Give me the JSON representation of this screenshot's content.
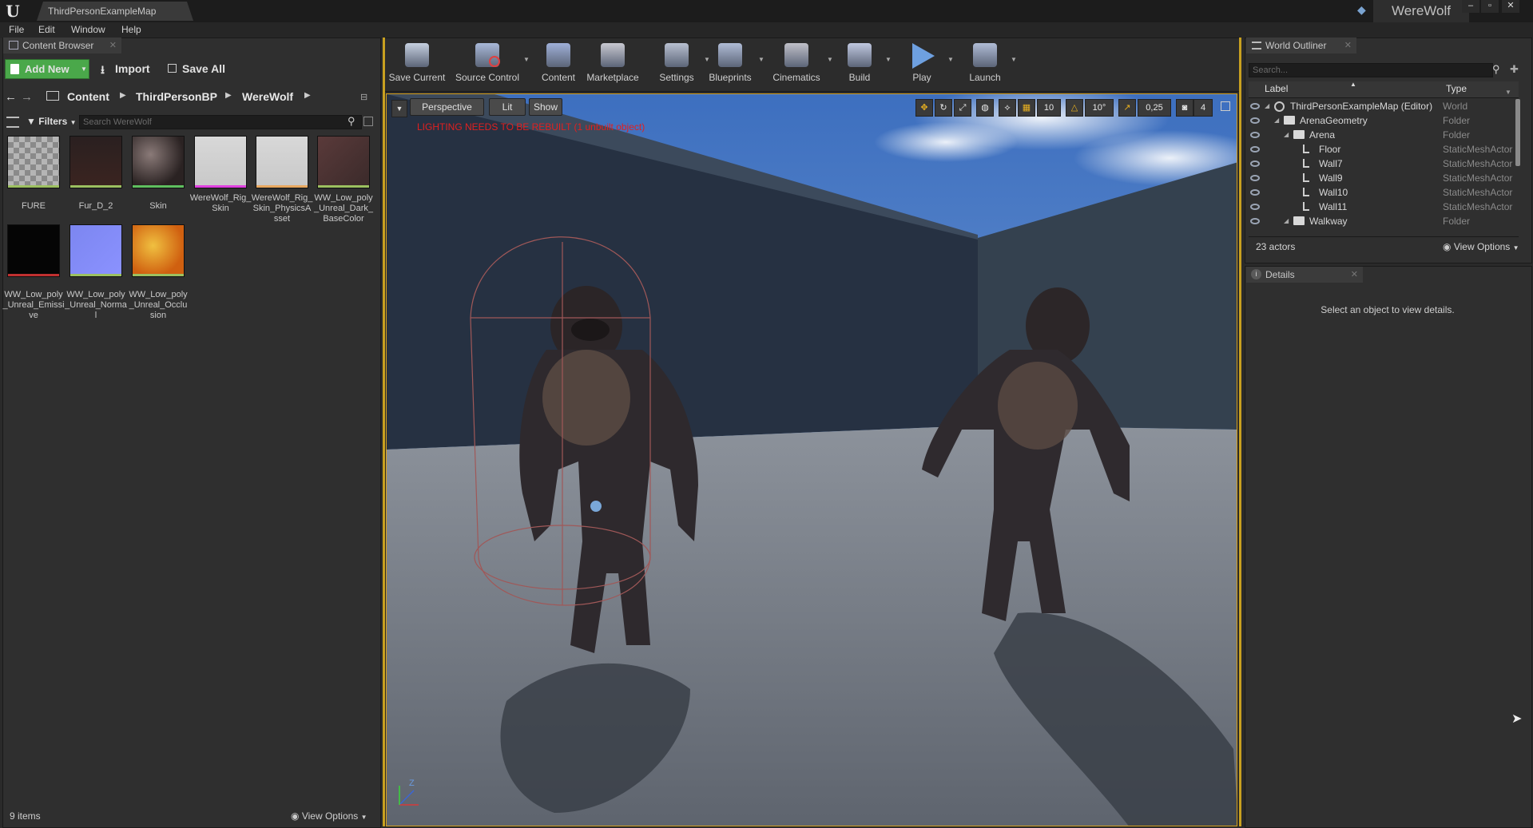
{
  "app": {
    "document_tab": "ThirdPersonExampleMap",
    "project_name": "WereWolf"
  },
  "menu": [
    "File",
    "Edit",
    "Window",
    "Help"
  ],
  "content_browser": {
    "tab_title": "Content Browser",
    "add_new": "Add New",
    "import": "Import",
    "save_all": "Save All",
    "breadcrumb": [
      "Content",
      "ThirdPersonBP",
      "WereWolf"
    ],
    "filters": "Filters",
    "search_placeholder": "Search WereWolf",
    "assets": [
      {
        "label": "FURE",
        "bar": "#9cc060"
      },
      {
        "label": "Fur_D_2",
        "bar": "#9cc060"
      },
      {
        "label": "Skin",
        "bar": "#5fbf5f"
      },
      {
        "label": "WereWolf_Rig_Skin",
        "bar": "#e040e0"
      },
      {
        "label": "WereWolf_Rig_Skin_PhysicsAsset",
        "bar": "#e8a860"
      },
      {
        "label": "WW_Low_poly_Unreal_Dark_BaseColor",
        "bar": "#9cc060"
      },
      {
        "label": "WW_Low_poly_Unreal_Emissive",
        "bar": "#c03030"
      },
      {
        "label": "WW_Low_poly_Unreal_Normal",
        "bar": "#9cc060"
      },
      {
        "label": "WW_Low_poly_Unreal_Occlusion",
        "bar": "#9cc060"
      }
    ],
    "item_count": "9 items",
    "view_options": "View Options"
  },
  "toolbar": [
    {
      "label": "Save Current",
      "icon": "save-icon",
      "dropdown": false
    },
    {
      "label": "Source Control",
      "icon": "source-control-icon",
      "dropdown": true
    },
    {
      "label": "Content",
      "icon": "content-icon",
      "dropdown": false
    },
    {
      "label": "Marketplace",
      "icon": "marketplace-icon",
      "dropdown": false
    },
    {
      "label": "Settings",
      "icon": "settings-icon",
      "dropdown": true
    },
    {
      "label": "Blueprints",
      "icon": "blueprints-icon",
      "dropdown": true
    },
    {
      "label": "Cinematics",
      "icon": "cinematics-icon",
      "dropdown": true
    },
    {
      "label": "Build",
      "icon": "build-icon",
      "dropdown": true
    },
    {
      "label": "Play",
      "icon": "play-icon",
      "dropdown": true
    },
    {
      "label": "Launch",
      "icon": "launch-icon",
      "dropdown": true
    }
  ],
  "viewport": {
    "perspective": "Perspective",
    "lit": "Lit",
    "show": "Show",
    "warning": "LIGHTING NEEDS TO BE REBUILT (1 unbuilt object)",
    "grid_snap": "10",
    "rotation_snap": "10°",
    "scale_snap": "0,25",
    "camera_speed": "4",
    "axis_z": "Z"
  },
  "world_outliner": {
    "tab_title": "World Outliner",
    "search_placeholder": "Search...",
    "col_label": "Label",
    "col_type": "Type",
    "rows": [
      {
        "label": "ThirdPersonExampleMap (Editor)",
        "type": "World",
        "depth": 0,
        "icon": "world-icon"
      },
      {
        "label": "ArenaGeometry",
        "type": "Folder",
        "depth": 1,
        "icon": "folder-icon"
      },
      {
        "label": "Arena",
        "type": "Folder",
        "depth": 2,
        "icon": "folder-icon"
      },
      {
        "label": "Floor",
        "type": "StaticMeshActor",
        "depth": 3,
        "icon": "static-mesh-icon"
      },
      {
        "label": "Wall7",
        "type": "StaticMeshActor",
        "depth": 3,
        "icon": "static-mesh-icon"
      },
      {
        "label": "Wall9",
        "type": "StaticMeshActor",
        "depth": 3,
        "icon": "static-mesh-icon"
      },
      {
        "label": "Wall10",
        "type": "StaticMeshActor",
        "depth": 3,
        "icon": "static-mesh-icon"
      },
      {
        "label": "Wall11",
        "type": "StaticMeshActor",
        "depth": 3,
        "icon": "static-mesh-icon"
      },
      {
        "label": "Walkway",
        "type": "Folder",
        "depth": 2,
        "icon": "folder-icon"
      }
    ],
    "actor_count": "23 actors",
    "view_options": "View Options"
  },
  "details": {
    "tab_title": "Details",
    "empty_message": "Select an object to view details."
  }
}
